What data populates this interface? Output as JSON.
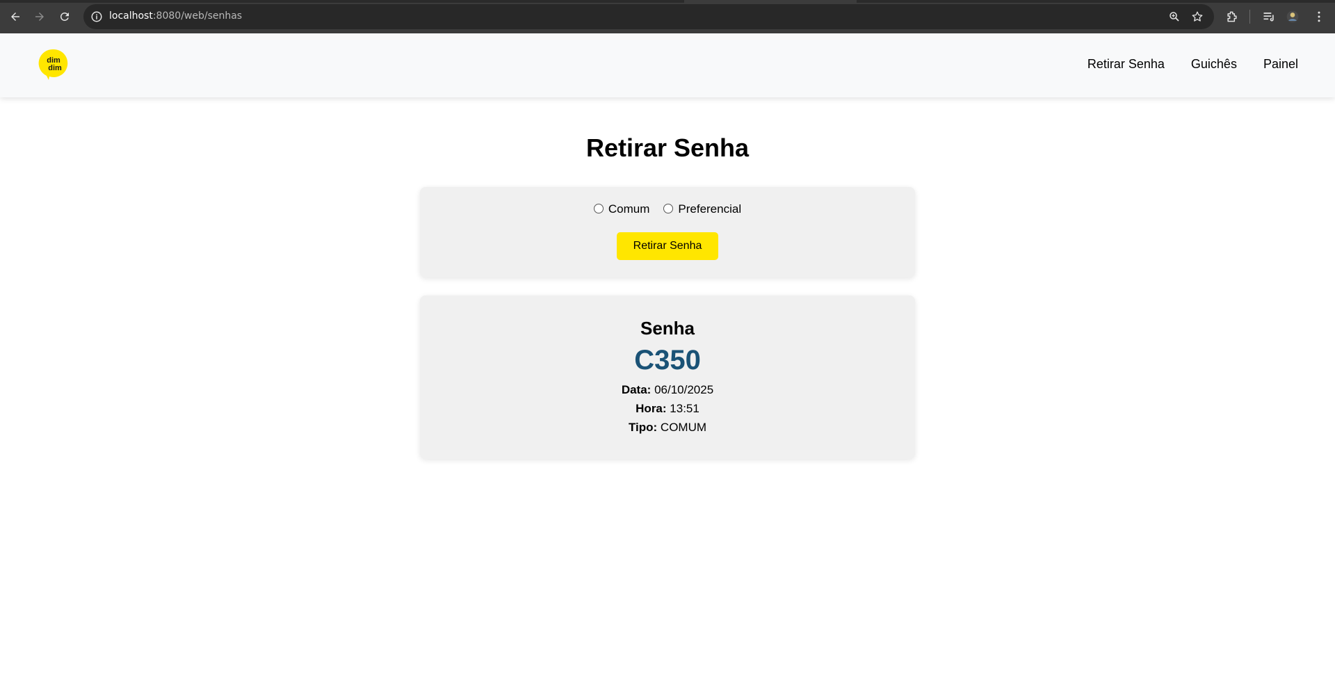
{
  "browser": {
    "url_host": "localhost",
    "url_rest": ":8080/web/senhas",
    "icons": [
      "back-icon",
      "forward-icon",
      "reload-icon",
      "site-info-icon",
      "zoom-icon",
      "bookmark-star-icon",
      "extensions-icon",
      "media-queue-icon",
      "profile-avatar-icon",
      "menu-icon"
    ]
  },
  "header": {
    "logo_text_line1": "dim",
    "logo_text_line2": "dim",
    "logo_color": "#ffe600",
    "nav": [
      {
        "label": "Retirar Senha"
      },
      {
        "label": "Guichês"
      },
      {
        "label": "Painel"
      }
    ]
  },
  "form": {
    "title": "Retirar Senha",
    "options": [
      {
        "label": "Comum",
        "selected": false
      },
      {
        "label": "Preferencial",
        "selected": false
      }
    ],
    "button_label": "Retirar Senha",
    "button_color": "#ffe600"
  },
  "ticket": {
    "heading": "Senha",
    "code": "C350",
    "code_color": "#1a5276",
    "date_label": "Data:",
    "date_value": "06/10/2025",
    "time_label": "Hora:",
    "time_value": "13:51",
    "type_label": "Tipo:",
    "type_value": "COMUM"
  }
}
